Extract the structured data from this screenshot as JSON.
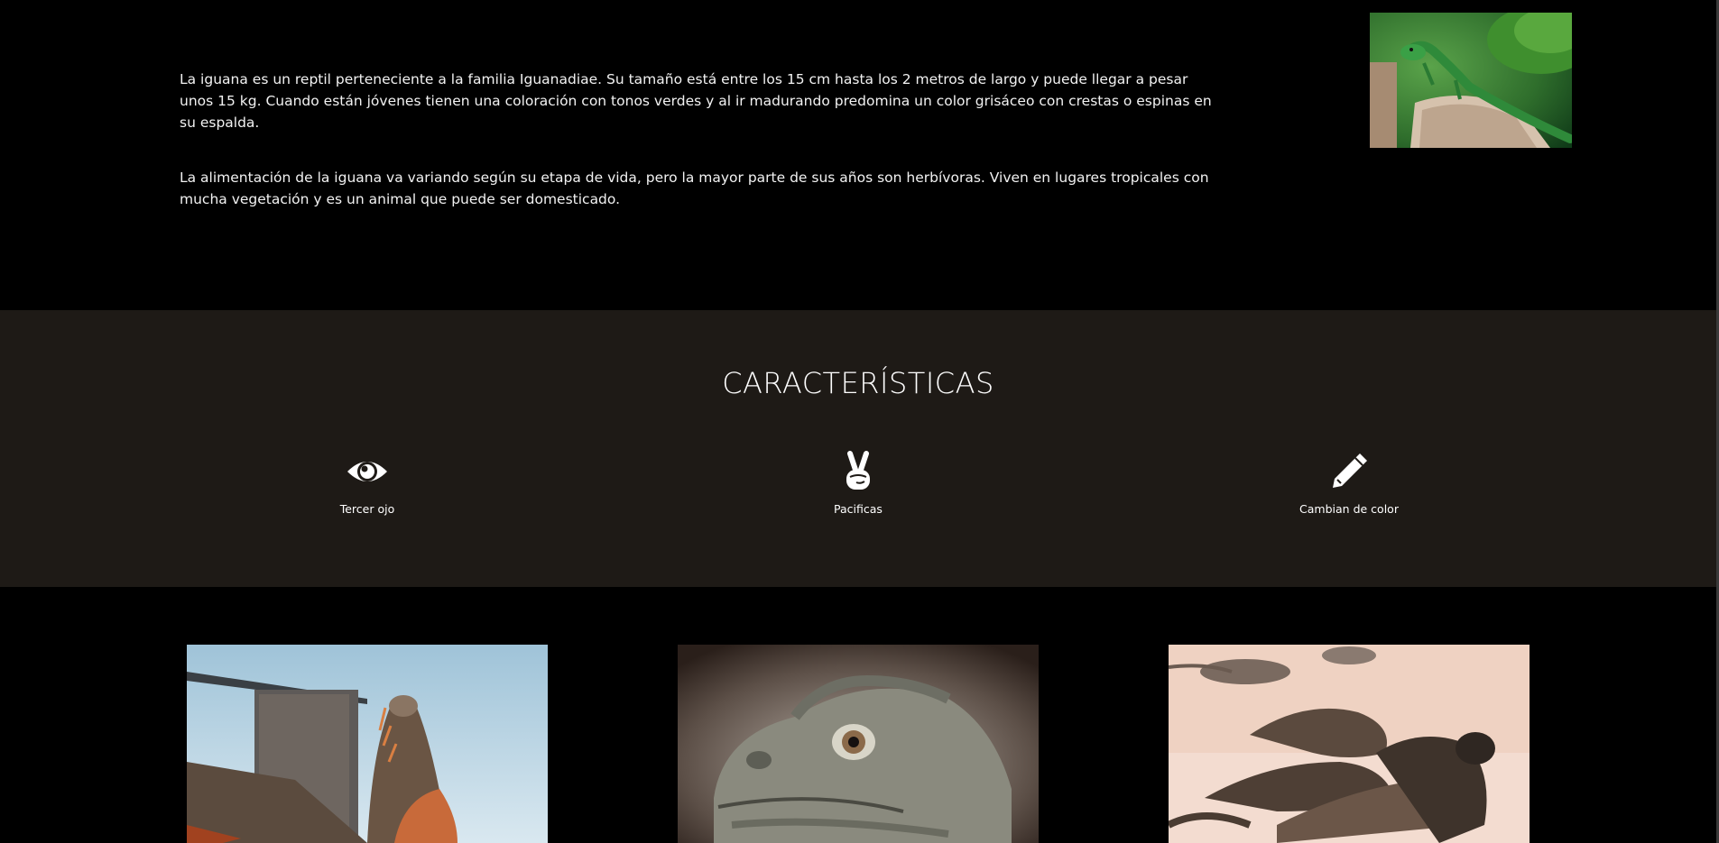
{
  "intro": {
    "paragraphs": [
      "La iguana es un reptil perteneciente a la familia Iguanadiae. Su tamaño está entre los 15 cm hasta los 2 metros de largo y puede llegar a pesar unos 15 kg. Cuando están jóvenes tienen una coloración con tonos verdes y al ir madurando predomina un color grisáceo con crestas o espinas en su espalda.",
      "La alimentación de la iguana va variando según su etapa de vida, pero la mayor parte de sus años son herbívoras. Viven en lugares tropicales con mucha vegetación y es un animal que puede ser domesticado."
    ],
    "photo_subject": "green-iguana-on-stump"
  },
  "features": {
    "title": "CARACTERÍSTICAS",
    "items": [
      {
        "icon": "eye-icon",
        "label": "Tercer ojo"
      },
      {
        "icon": "peace-hand-icon",
        "label": "Pacificas"
      },
      {
        "icon": "pencil-icon",
        "label": "Cambian de color"
      }
    ]
  },
  "gallery": {
    "photos": [
      "iguana-by-water",
      "iguana-head-closeup",
      "iguanas-on-beach"
    ]
  },
  "colors": {
    "page_background": "#000000",
    "features_background": "#1e1a16",
    "text": "#ffffff"
  }
}
